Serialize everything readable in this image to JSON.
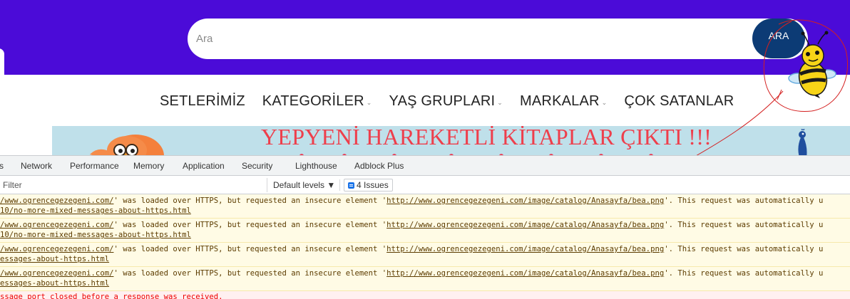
{
  "header": {
    "search_placeholder": "Ara",
    "search_button_label": "ARA"
  },
  "nav": {
    "items": [
      {
        "label": "SETLERİMİZ",
        "has_dropdown": false
      },
      {
        "label": "KATEGORİLER",
        "has_dropdown": true
      },
      {
        "label": "YAŞ GRUPLARI",
        "has_dropdown": true
      },
      {
        "label": "MARKALAR",
        "has_dropdown": true
      },
      {
        "label": "ÇOK SATANLAR",
        "has_dropdown": false
      }
    ]
  },
  "banner": {
    "headline": "YEPYENİ HAREKETLİ KİTAPLAR ÇIKTI !!!"
  },
  "devtools": {
    "tabs": [
      "s",
      "Network",
      "Performance",
      "Memory",
      "Application",
      "Security",
      "Lighthouse",
      "Adblock Plus"
    ],
    "filter_placeholder": "Filter",
    "levels_label": "Default levels",
    "issues_label": "4 Issues",
    "messages": [
      {
        "url": "/www.ogrencegezegeni.com/",
        "mid": "' was loaded over HTTPS, but requested an insecure element '",
        "element": "http://www.ogrencegezegeni.com/image/catalog/Anasayfa/bea.png",
        "tail": "'. This request was automatically u",
        "line2": "10/no-more-mixed-messages-about-https.html"
      },
      {
        "url": "/www.ogrencegezegeni.com/",
        "mid": "' was loaded over HTTPS, but requested an insecure element '",
        "element": "http://www.ogrencegezegeni.com/image/catalog/Anasayfa/bea.png",
        "tail": "'. This request was automatically u",
        "line2": "10/no-more-mixed-messages-about-https.html"
      },
      {
        "url": "/www.ogrencegezegeni.com/",
        "mid": "' was loaded over HTTPS, but requested an insecure element '",
        "element": "http://www.ogrencegezegeni.com/image/catalog/Anasayfa/bea.png",
        "tail": "'. This request was automatically u",
        "line2": "essages-about-https.html"
      },
      {
        "url": "/www.ogrencegezegeni.com/",
        "mid": "' was loaded over HTTPS, but requested an insecure element '",
        "element": "http://www.ogrencegezegeni.com/image/catalog/Anasayfa/bea.png",
        "tail": "'. This request was automatically u",
        "line2": "essages-about-https.html"
      }
    ],
    "error_message": "ssage port closed before a response was received."
  },
  "colors": {
    "header_bg": "#4b0bd8",
    "search_button_bg": "#0c3b75",
    "banner_bg": "#bfe0ea",
    "banner_text": "#ee3f4c",
    "warning_bg": "#fffbe5",
    "warning_text": "#5c3c00",
    "annotation_red": "#d42020"
  }
}
